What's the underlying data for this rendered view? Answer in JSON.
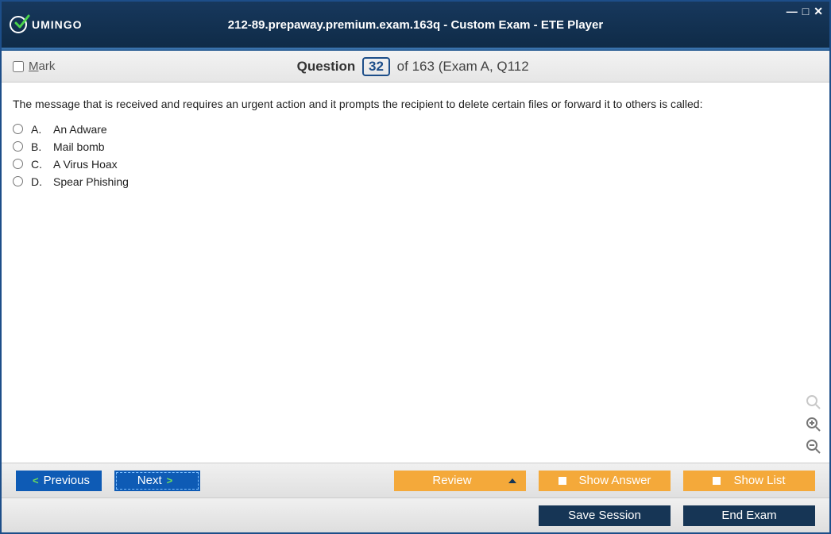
{
  "window": {
    "logo_text": "UMINGO",
    "title": "212-89.prepaway.premium.exam.163q - Custom Exam - ETE Player"
  },
  "header": {
    "mark_label": "Mark",
    "question_word": "Question",
    "current": "32",
    "of_label": "of",
    "total": "163",
    "exam_ref": "(Exam A, Q112"
  },
  "question": {
    "text": "The message that is received and requires an urgent action and it prompts the recipient to delete certain files or forward it to others is called:",
    "options": [
      {
        "letter": "A.",
        "label": "An Adware"
      },
      {
        "letter": "B.",
        "label": "Mail bomb"
      },
      {
        "letter": "C.",
        "label": "A Virus Hoax"
      },
      {
        "letter": "D.",
        "label": "Spear Phishing"
      }
    ]
  },
  "buttons": {
    "previous": "Previous",
    "next": "Next",
    "review": "Review",
    "show_answer": "Show Answer",
    "show_list": "Show List",
    "save_session": "Save Session",
    "end_exam": "End Exam"
  }
}
